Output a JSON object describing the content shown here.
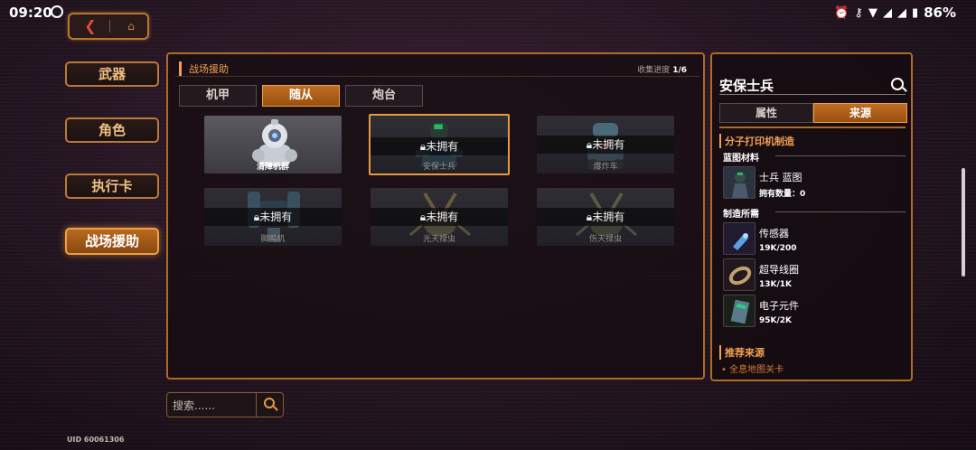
{
  "status_bar": {
    "time": "09:20",
    "battery": "86%",
    "icons": [
      "alarm-icon",
      "key-icon",
      "wifi-icon",
      "signal-icon",
      "signal-icon",
      "battery-icon"
    ]
  },
  "nav": {
    "back_icon": "back-arrow-icon",
    "home_icon": "home-icon"
  },
  "sidebar": {
    "items": [
      {
        "label": "武器",
        "active": false
      },
      {
        "label": "角色",
        "active": false
      },
      {
        "label": "执行卡",
        "active": false
      },
      {
        "label": "战场援助",
        "active": true
      }
    ]
  },
  "main": {
    "title": "战场援助",
    "progress_label": "收集进度",
    "progress_value": "1/6",
    "tabs": [
      {
        "label": "机甲",
        "active": false
      },
      {
        "label": "随从",
        "active": true
      },
      {
        "label": "炮台",
        "active": false
      }
    ],
    "locked_label": "未拥有",
    "cards": [
      {
        "name": "清障机群",
        "owned": true,
        "selected": false
      },
      {
        "name": "安保士兵",
        "owned": false,
        "selected": true
      },
      {
        "name": "爆炸车",
        "owned": false,
        "selected": false
      },
      {
        "name": "脚鸣机",
        "owned": false,
        "selected": false
      },
      {
        "name": "光天禄虫",
        "owned": false,
        "selected": false
      },
      {
        "name": "伤天禄虫",
        "owned": false,
        "selected": false
      }
    ]
  },
  "detail": {
    "name": "安保士兵",
    "tabs": [
      {
        "label": "属性",
        "active": false
      },
      {
        "label": "来源",
        "active": true
      }
    ],
    "section_title": "分子打印机制造",
    "blueprint_title": "蓝图材料",
    "blueprint": {
      "name": "士兵 蓝图",
      "count": "拥有数量：0"
    },
    "required_title": "制造所需",
    "materials": [
      {
        "name": "传感器",
        "count": "19K/200",
        "icon": "sensor-icon"
      },
      {
        "name": "超导线圈",
        "count": "13K/1K",
        "icon": "coil-icon"
      },
      {
        "name": "电子元件",
        "count": "95K/2K",
        "icon": "chip-icon"
      }
    ],
    "source_title": "推荐来源",
    "source_link": "• 全息地图关卡"
  },
  "search": {
    "placeholder": "搜索......"
  },
  "uid": "UID 60061306"
}
